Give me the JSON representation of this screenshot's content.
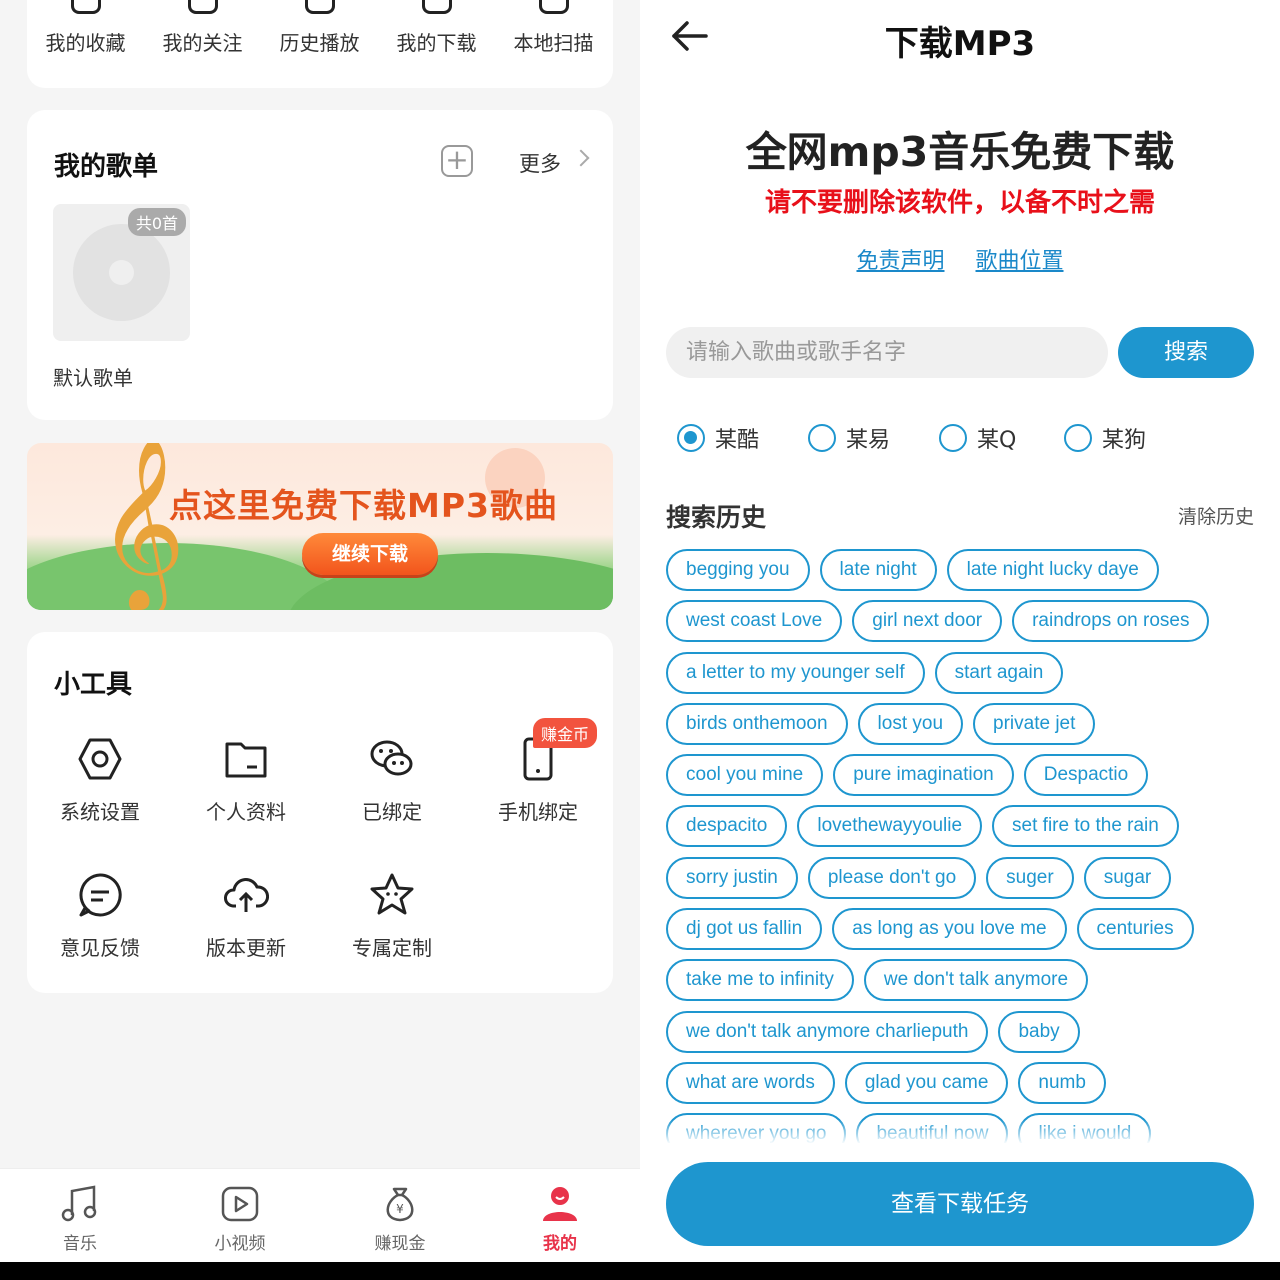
{
  "left": {
    "quick_actions": [
      "我的收藏",
      "我的关注",
      "历史播放",
      "我的下载",
      "本地扫描"
    ],
    "playlist": {
      "title": "我的歌单",
      "more_label": "更多",
      "count_badge": "共0首",
      "default_name": "默认歌单"
    },
    "banner": {
      "text": "点这里免费下载MP3歌曲",
      "button": "继续下载"
    },
    "tools": {
      "title": "小工具",
      "items": [
        "系统设置",
        "个人资料",
        "已绑定",
        "手机绑定",
        "意见反馈",
        "版本更新",
        "专属定制"
      ],
      "earn_badge": "赚金币"
    },
    "nav": {
      "items": [
        "音乐",
        "小视频",
        "赚现金",
        "我的"
      ],
      "active": "我的",
      "active_color": "#e8334a"
    }
  },
  "right": {
    "title": "下载MP3",
    "headline": "全网mp3音乐免费下载",
    "warning": "请不要删除该软件，以备不时之需",
    "links": [
      "免责声明",
      "歌曲位置"
    ],
    "search": {
      "placeholder": "请输入歌曲或歌手名字",
      "button": "搜索"
    },
    "sources": [
      "某酷",
      "某易",
      "某Q",
      "某狗"
    ],
    "selected_source": "某酷",
    "history_title": "搜索历史",
    "clear_history": "清除历史",
    "history": [
      [
        "begging you",
        "late night",
        "late night lucky daye"
      ],
      [
        "west coast Love",
        "girl next door",
        "raindrops on roses"
      ],
      [
        "a letter to my younger self",
        "start again"
      ],
      [
        "birds onthemoon",
        "lost you",
        "private jet"
      ],
      [
        "cool you mine",
        "pure imagination",
        "Despactio"
      ],
      [
        "despacito",
        "lovethewayyoulie",
        "set fire to the rain"
      ],
      [
        "sorry justin",
        "please don't go",
        "suger",
        "sugar"
      ],
      [
        "dj got us fallin",
        "as long as you love me",
        "centuries"
      ],
      [
        "take me to infinity",
        "we don't talk anymore"
      ],
      [
        "we don't talk anymore charlieputh",
        "baby"
      ],
      [
        "what are words",
        "glad you came",
        "numb"
      ],
      [
        "wherever you go",
        "beautiful now",
        "like i would"
      ]
    ],
    "tasks_button": "查看下载任务",
    "accent_color": "#1e96cf",
    "warning_color": "#e8101a"
  }
}
